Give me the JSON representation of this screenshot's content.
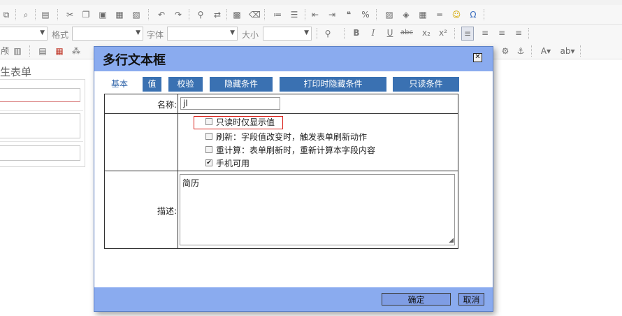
{
  "editor": {
    "toolbar_row2": {
      "format_label": "格式",
      "font_label": "字体",
      "size_label": "大小"
    },
    "form_title_fragment": "生表单"
  },
  "dialog": {
    "title": "多行文本框",
    "close_symbol": "⊠",
    "tabs": [
      {
        "label": "基本",
        "active": true
      },
      {
        "label": "值",
        "active": false
      },
      {
        "label": "校验",
        "active": false
      },
      {
        "label": "隐藏条件",
        "active": false
      },
      {
        "label": "打印时隐藏条件",
        "active": false
      },
      {
        "label": "只读条件",
        "active": false
      }
    ],
    "name_label": "名称:",
    "name_value": "jl",
    "options": [
      {
        "label": "只读时仅显示值",
        "checked": false
      },
      {
        "label": "刷新：字段值改变时，触发表单刷新动作",
        "checked": false
      },
      {
        "label": "重计算：表单刷新时，重新计算本字段内容",
        "checked": false
      },
      {
        "label": "手机可用",
        "checked": true
      }
    ],
    "desc_label": "描述:",
    "desc_value": "简历",
    "ok_label": "确定",
    "cancel_label": "取消"
  }
}
